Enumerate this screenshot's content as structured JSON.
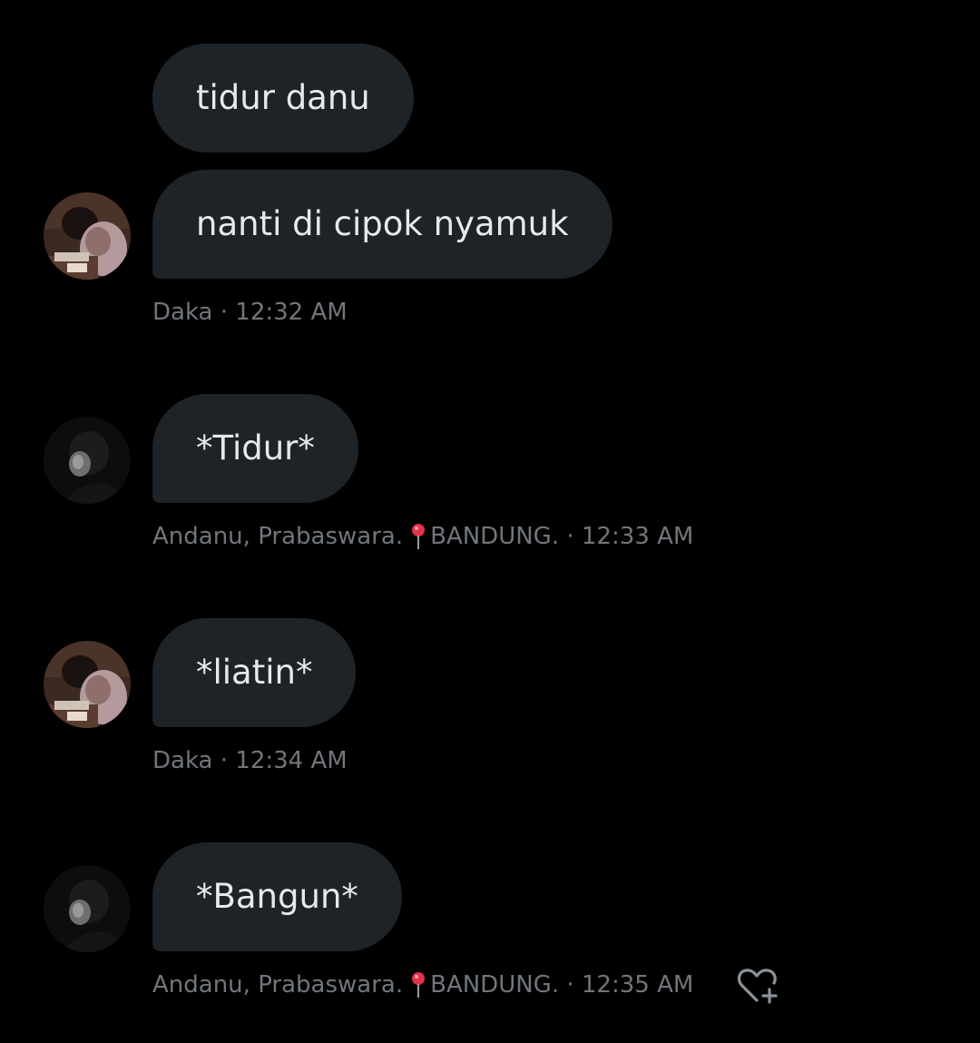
{
  "messages": [
    {
      "text": "tidur danu"
    },
    {
      "text": "nanti di cipok nyamuk",
      "meta": {
        "name": "Daka",
        "time": "12:32 AM"
      }
    },
    {
      "text": "*Tidur*",
      "meta": {
        "name": "Andanu, Prabaswara.",
        "location": "BANDUNG.",
        "time": "12:33 AM"
      }
    },
    {
      "text": "*liatin*",
      "meta": {
        "name": "Daka",
        "time": "12:34 AM"
      }
    },
    {
      "text": "*Bangun*",
      "meta": {
        "name": "Andanu, Prabaswara.",
        "location": "BANDUNG.",
        "time": "12:35 AM"
      }
    }
  ],
  "separator": " · ",
  "icons": {
    "pin": "round-pushpin-icon",
    "reaction": "heart-plus-icon"
  },
  "colors": {
    "background": "#000000",
    "bubble": "#1e2328",
    "bubble_text": "#e7e9ea",
    "meta_text": "#71767b",
    "pin": "#e0334b"
  }
}
